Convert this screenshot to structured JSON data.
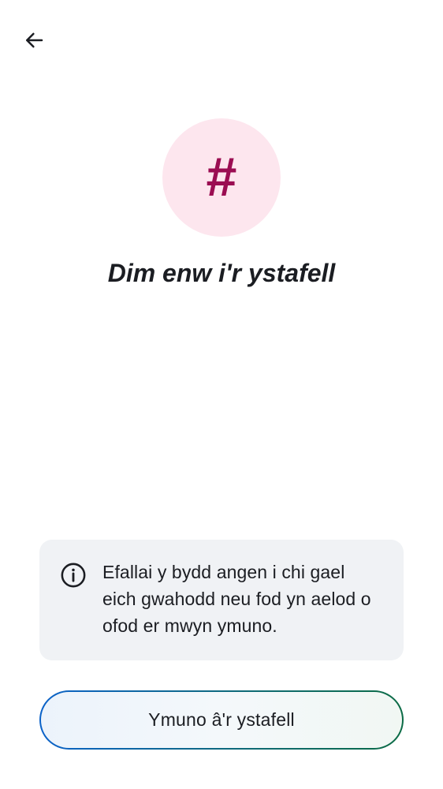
{
  "header": {
    "back_icon": "arrow-left-icon"
  },
  "room": {
    "avatar_icon": "hash-icon",
    "avatar_glyph": "#",
    "name": "Dim enw i'r ystafell",
    "colors": {
      "avatar_bg": "#fde6ee",
      "avatar_fg": "#9b0d52"
    }
  },
  "notice": {
    "icon": "info-icon",
    "text": "Efallai y bydd angen i chi gael eich gwahodd neu fod yn aelod o ofod er mwyn ymuno."
  },
  "actions": {
    "join_label": "Ymuno â'r ystafell",
    "colors": {
      "border_start": "#0b62c9",
      "border_end": "#0b6b45"
    }
  }
}
